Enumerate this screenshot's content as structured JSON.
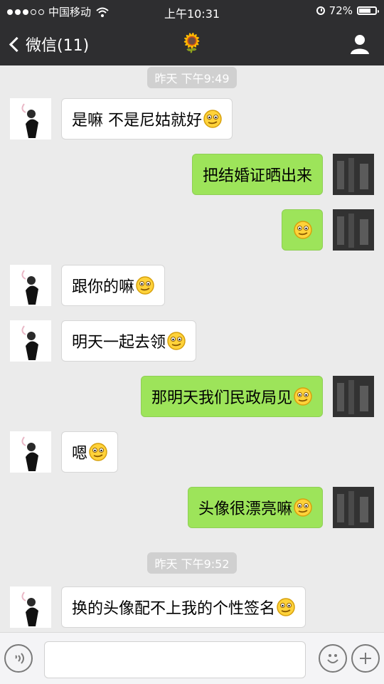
{
  "status_bar": {
    "carrier": "中国移动",
    "time": "上午10:31",
    "battery_text": "72%",
    "battery_level": 0.72,
    "signal_filled": 3,
    "signal_total": 5
  },
  "nav": {
    "back_label": "微信(11)",
    "title": "🌻"
  },
  "timestamps": [
    "昨天 下午9:49",
    "昨天 下午9:52"
  ],
  "messages": [
    {
      "side": "left",
      "text": "是嘛 不是尼姑就好",
      "emoji": "awkward-smile-icon"
    },
    {
      "side": "right",
      "text": "把结婚证晒出来",
      "emoji": ""
    },
    {
      "side": "right",
      "text": "",
      "emoji": "awkward-smile-icon"
    },
    {
      "side": "left",
      "text": "跟你的嘛",
      "emoji": "awkward-smile-icon"
    },
    {
      "side": "left",
      "text": "明天一起去领",
      "emoji": "awkward-smile-icon"
    },
    {
      "side": "right",
      "text": "那明天我们民政局见",
      "emoji": "awkward-smile-icon"
    },
    {
      "side": "left",
      "text": "嗯",
      "emoji": "awkward-smile-icon"
    },
    {
      "side": "right",
      "text": "头像很漂亮嘛",
      "emoji": "awkward-smile-icon"
    },
    {
      "side": "left",
      "text": "换的头像配不上我的个性签名",
      "emoji": "awkward-smile-icon"
    }
  ],
  "input": {
    "placeholder": "",
    "value": ""
  },
  "icons": {
    "voice": "voice-icon",
    "emoji": "emoji-icon",
    "plus": "plus-icon"
  },
  "colors": {
    "top_bar": "#2e2e30",
    "chat_bg": "#ebebeb",
    "bubble_self": "#9de45a",
    "bubble_other": "#ffffff"
  }
}
